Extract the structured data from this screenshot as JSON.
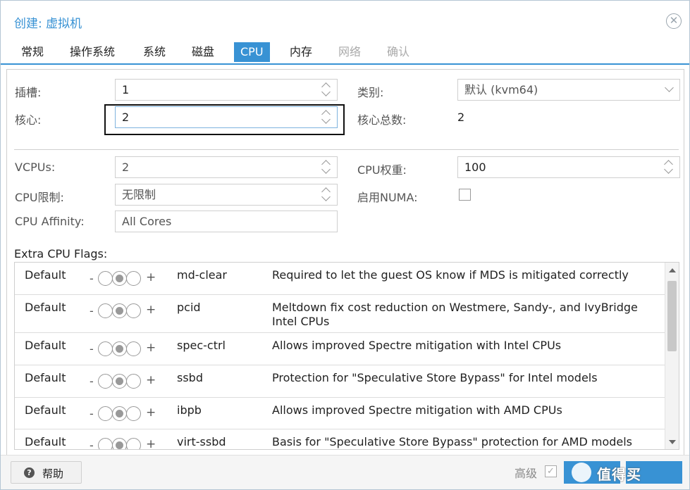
{
  "window": {
    "title": "创建: 虚拟机"
  },
  "tabs": [
    {
      "label": "常规"
    },
    {
      "label": "操作系统"
    },
    {
      "label": "系统"
    },
    {
      "label": "磁盘"
    },
    {
      "label": "CPU"
    },
    {
      "label": "内存"
    },
    {
      "label": "网络"
    },
    {
      "label": "确认"
    }
  ],
  "fields": {
    "sockets": {
      "label": "插槽:",
      "value": "1"
    },
    "cores": {
      "label": "核心:",
      "value": "2"
    },
    "type": {
      "label": "类别:",
      "value": "默认 (kvm64)"
    },
    "total_cores": {
      "label": "核心总数:",
      "value": "2"
    },
    "vcpus": {
      "label": "VCPUs:",
      "value": "2"
    },
    "cpu_weight": {
      "label": "CPU权重:",
      "value": "100"
    },
    "cpu_limit": {
      "label": "CPU限制:",
      "value": "无限制"
    },
    "numa": {
      "label": "启用NUMA:"
    },
    "affinity": {
      "label": "CPU Affinity:",
      "value": "All Cores"
    }
  },
  "flags": {
    "label": "Extra CPU Flags:",
    "minus": "-",
    "plus": "+",
    "rows": [
      {
        "state": "Default",
        "name": "md-clear",
        "desc": "Required to let the guest OS know if MDS is mitigated correctly"
      },
      {
        "state": "Default",
        "name": "pcid",
        "desc": "Meltdown fix cost reduction on Westmere, Sandy-, and IvyBridge Intel CPUs"
      },
      {
        "state": "Default",
        "name": "spec-ctrl",
        "desc": "Allows improved Spectre mitigation with Intel CPUs"
      },
      {
        "state": "Default",
        "name": "ssbd",
        "desc": "Protection for \"Speculative Store Bypass\" for Intel models"
      },
      {
        "state": "Default",
        "name": "ibpb",
        "desc": "Allows improved Spectre mitigation with AMD CPUs"
      },
      {
        "state": "Default",
        "name": "virt-ssbd",
        "desc": "Basis for \"Speculative Store Bypass\" protection for AMD models"
      }
    ]
  },
  "footer": {
    "help_label": "帮助",
    "advanced_label": "高级",
    "watermark": "值得买"
  },
  "colors": {
    "accent": "#3892d4",
    "border": "#cfcfcf"
  }
}
